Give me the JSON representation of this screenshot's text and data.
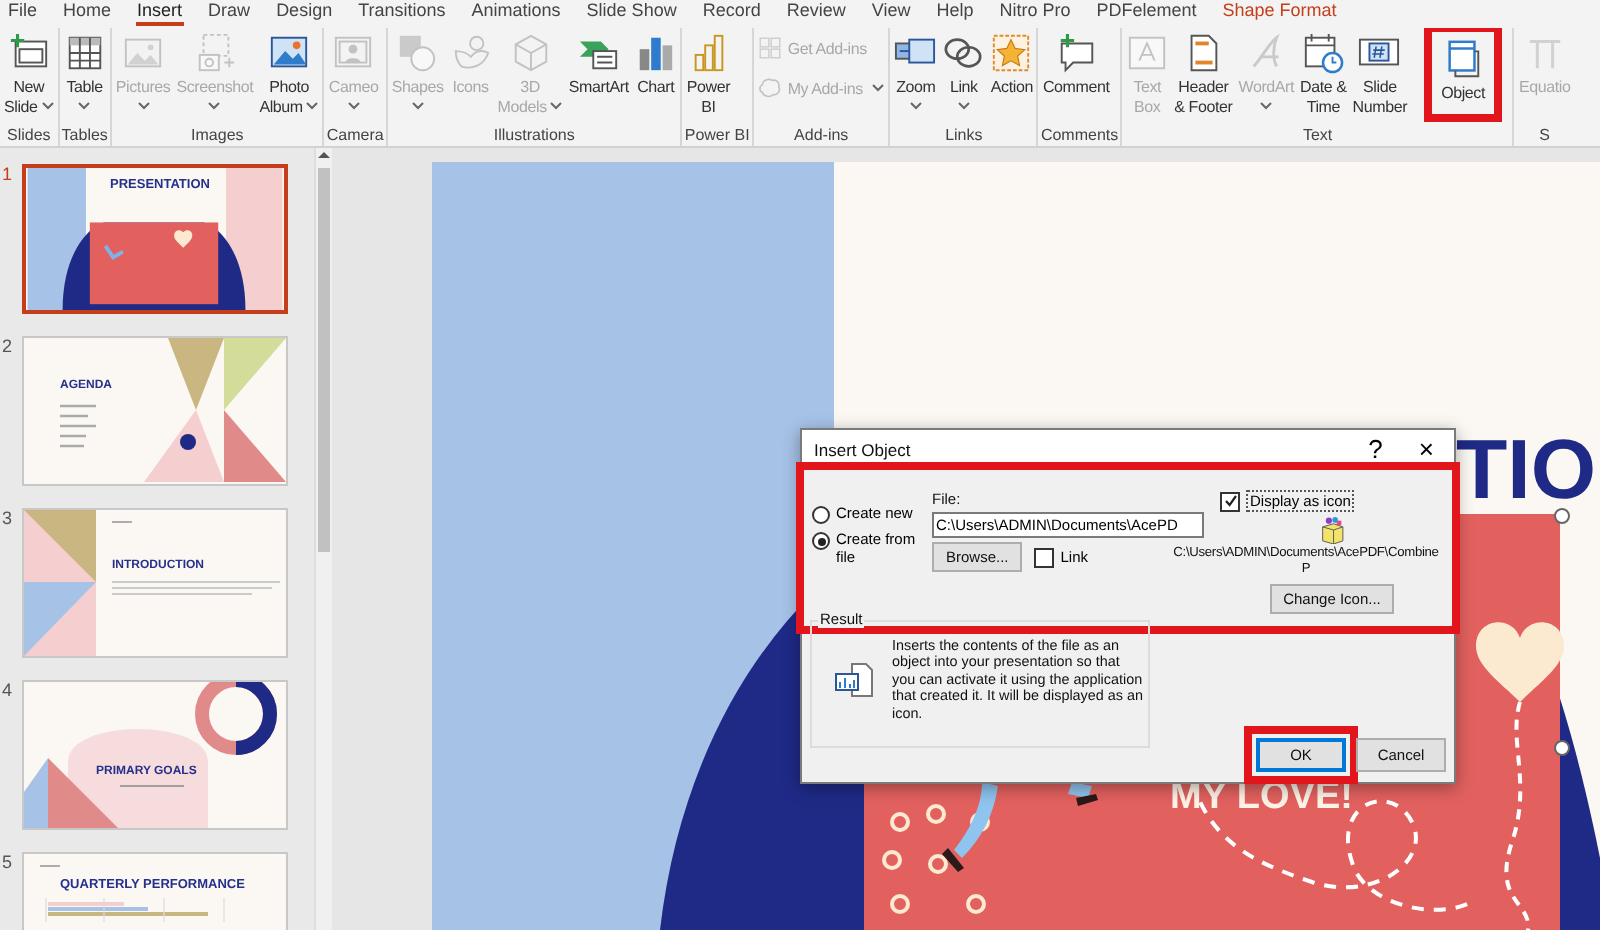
{
  "ribbon_tabs": [
    {
      "label": "File",
      "selected": false,
      "kind": "normal"
    },
    {
      "label": "Home",
      "selected": false,
      "kind": "normal"
    },
    {
      "label": "Insert",
      "selected": true,
      "kind": "normal"
    },
    {
      "label": "Draw",
      "selected": false,
      "kind": "normal"
    },
    {
      "label": "Design",
      "selected": false,
      "kind": "normal"
    },
    {
      "label": "Transitions",
      "selected": false,
      "kind": "normal"
    },
    {
      "label": "Animations",
      "selected": false,
      "kind": "normal"
    },
    {
      "label": "Slide Show",
      "selected": false,
      "kind": "normal"
    },
    {
      "label": "Record",
      "selected": false,
      "kind": "normal"
    },
    {
      "label": "Review",
      "selected": false,
      "kind": "normal"
    },
    {
      "label": "View",
      "selected": false,
      "kind": "normal"
    },
    {
      "label": "Help",
      "selected": false,
      "kind": "normal"
    },
    {
      "label": "Nitro Pro",
      "selected": false,
      "kind": "normal"
    },
    {
      "label": "PDFelement",
      "selected": false,
      "kind": "normal"
    },
    {
      "label": "Shape Format",
      "selected": false,
      "kind": "contextual"
    }
  ],
  "ribbon_groups": [
    {
      "label": "Slides",
      "buttons": [
        {
          "label": "New\nSlide",
          "kind": "large",
          "dropdown": true,
          "disabled": false,
          "highlighted": false
        }
      ]
    },
    {
      "label": "Tables",
      "buttons": [
        {
          "label": "Table",
          "kind": "large",
          "dropdown": true,
          "disabled": false,
          "highlighted": false
        }
      ]
    },
    {
      "label": "Images",
      "buttons": [
        {
          "label": "Pictures",
          "kind": "large",
          "dropdown": true,
          "disabled": true,
          "highlighted": false
        },
        {
          "label": "Screenshot",
          "kind": "large",
          "dropdown": true,
          "disabled": true,
          "highlighted": false
        },
        {
          "label": "Photo\nAlbum",
          "kind": "large",
          "dropdown": true,
          "disabled": false,
          "highlighted": false
        }
      ]
    },
    {
      "label": "Camera",
      "buttons": [
        {
          "label": "Cameo",
          "kind": "large",
          "dropdown": true,
          "disabled": true,
          "highlighted": false
        }
      ]
    },
    {
      "label": "Illustrations",
      "buttons": [
        {
          "label": "Shapes",
          "kind": "large",
          "dropdown": true,
          "disabled": true,
          "highlighted": false
        },
        {
          "label": "Icons",
          "kind": "large",
          "dropdown": false,
          "disabled": true,
          "highlighted": false
        },
        {
          "label": "3D\nModels",
          "kind": "large",
          "dropdown": true,
          "disabled": true,
          "highlighted": false
        },
        {
          "label": "SmartArt",
          "kind": "large",
          "dropdown": false,
          "disabled": false,
          "highlighted": false
        },
        {
          "label": "Chart",
          "kind": "large",
          "dropdown": false,
          "disabled": false,
          "highlighted": false
        }
      ]
    },
    {
      "label": "Power BI",
      "buttons": [
        {
          "label": "Power\nBI",
          "kind": "large",
          "dropdown": false,
          "disabled": false,
          "highlighted": false
        }
      ]
    },
    {
      "label": "Add-ins",
      "buttons": [
        {
          "label": "Get Add-ins",
          "kind": "small",
          "dropdown": false,
          "disabled": true,
          "highlighted": false
        },
        {
          "label": "My Add-ins",
          "kind": "small",
          "dropdown": true,
          "disabled": true,
          "highlighted": false
        }
      ]
    },
    {
      "label": "Links",
      "buttons": [
        {
          "label": "Zoom",
          "kind": "large",
          "dropdown": true,
          "disabled": false,
          "highlighted": false
        },
        {
          "label": "Link",
          "kind": "large",
          "dropdown": true,
          "disabled": false,
          "highlighted": false
        },
        {
          "label": "Action",
          "kind": "large",
          "dropdown": false,
          "disabled": false,
          "highlighted": false
        }
      ]
    },
    {
      "label": "Comments",
      "buttons": [
        {
          "label": "Comment",
          "kind": "large",
          "dropdown": false,
          "disabled": false,
          "highlighted": false
        }
      ]
    },
    {
      "label": "Text",
      "buttons": [
        {
          "label": "Text\nBox",
          "kind": "large",
          "dropdown": false,
          "disabled": true,
          "highlighted": false
        },
        {
          "label": "Header\n& Footer",
          "kind": "large",
          "dropdown": false,
          "disabled": false,
          "highlighted": false
        },
        {
          "label": "WordArt",
          "kind": "large",
          "dropdown": true,
          "disabled": true,
          "highlighted": false
        },
        {
          "label": "Date &\nTime",
          "kind": "large",
          "dropdown": false,
          "disabled": false,
          "highlighted": false
        },
        {
          "label": "Slide\nNumber",
          "kind": "large",
          "dropdown": false,
          "disabled": false,
          "highlighted": false
        },
        {
          "label": "Object",
          "kind": "large",
          "dropdown": false,
          "disabled": false,
          "highlighted": true
        }
      ]
    },
    {
      "label": "S",
      "buttons": [
        {
          "label": "Equatio",
          "kind": "large",
          "dropdown": false,
          "disabled": true,
          "highlighted": false
        }
      ]
    }
  ],
  "slides": [
    {
      "number": "1",
      "selected": true,
      "kind": "title",
      "title": "PRESENTATION"
    },
    {
      "number": "2",
      "selected": false,
      "kind": "agenda",
      "title": "AGENDA"
    },
    {
      "number": "3",
      "selected": false,
      "kind": "intro",
      "title": "INTRODUCTION"
    },
    {
      "number": "4",
      "selected": false,
      "kind": "goals",
      "title": "PRIMARY GOALS"
    },
    {
      "number": "5",
      "selected": false,
      "kind": "chart",
      "title": "QUARTERLY PERFORMANCE"
    }
  ],
  "canvas": {
    "title_fragment": "TIO",
    "card_text": "MY LOVE!",
    "card_selected": true
  },
  "dialog": {
    "title": "Insert Object",
    "help": "?",
    "close": "×",
    "options_highlighted": true,
    "options": [
      {
        "label": "Create new",
        "selected": false
      },
      {
        "label": "Create from file",
        "selected": true
      }
    ],
    "file_label": "File:",
    "file_value": "C:\\Users\\ADMIN\\Documents\\AcePD",
    "browse": "Browse...",
    "link": {
      "label": "Link",
      "checked": false
    },
    "display_as_icon": {
      "label": "Display as icon",
      "checked": true
    },
    "icon_caption_lines": [
      "C:\\Users\\ADMIN\\Documents\\AcePDF\\Combine",
      "P"
    ],
    "change_icon": "Change Icon...",
    "result_label": "Result",
    "result_text": "Inserts the contents of the file as an object into your presentation so that you can activate it using the application that created it. It will be displayed as an icon.",
    "buttons": [
      {
        "label": "OK",
        "default": true,
        "highlighted": true
      },
      {
        "label": "Cancel",
        "default": false,
        "highlighted": false
      }
    ]
  }
}
